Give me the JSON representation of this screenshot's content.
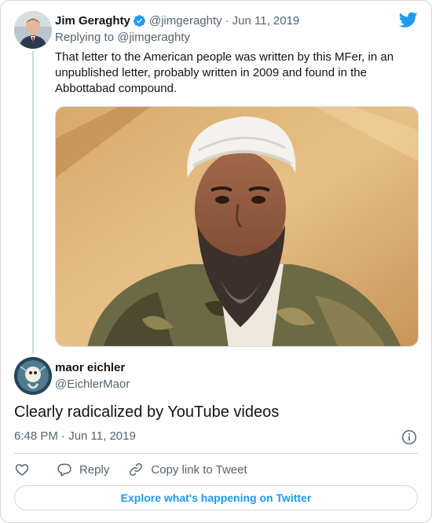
{
  "parent_tweet": {
    "author_name": "Jim Geraghty",
    "handle": "@jimgeraghty",
    "separator": "·",
    "date": "Jun 11, 2019",
    "replying_to": "Replying to @jimgeraghty",
    "text": "That letter to the American people was written by this MFer, in an unpublished letter, probably written in 2009 and found in the Abbottabad compound.",
    "avatar_icon": "user-avatar",
    "verified_icon": "verified-badge-icon",
    "media_icon": "photo"
  },
  "brand": {
    "icon": "twitter-bird-icon",
    "color": "#1d9bf0"
  },
  "main_tweet": {
    "author_name": "maor eichler",
    "handle": "@EichlerMaor",
    "text": "Clearly radicalized by YouTube videos",
    "timestamp": "6:48 PM · Jun 11, 2019",
    "avatar_icon": "user-avatar",
    "info_icon": "info-icon"
  },
  "actions": {
    "like_icon": "heart-icon",
    "reply_label": "Reply",
    "copy_label": "Copy link to Tweet"
  },
  "footer": {
    "explore_label": "Explore what's happening on Twitter"
  },
  "colors": {
    "text_primary": "#0f1419",
    "text_secondary": "#536471",
    "border": "#cfd9de",
    "accent": "#1d9bf0"
  }
}
